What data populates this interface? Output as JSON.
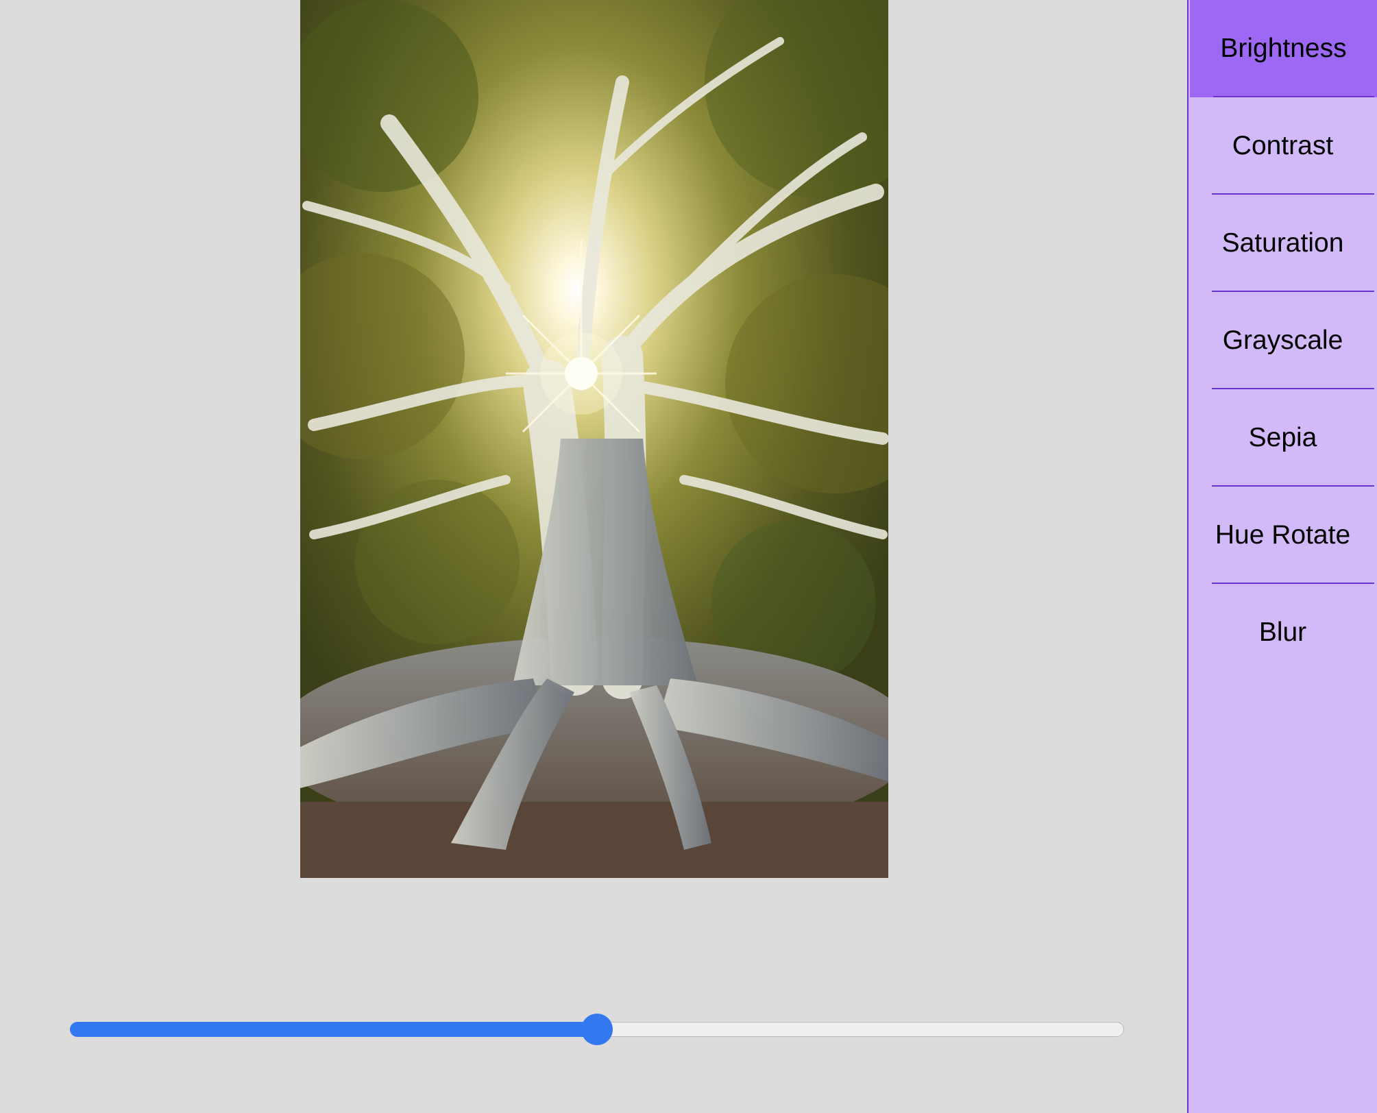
{
  "photo": {
    "subject": "large banyan tree with sun shining through branches"
  },
  "slider": {
    "value_fraction": 0.5,
    "track_color": "#efefef",
    "fill_color": "#3478f0"
  },
  "sidebar": {
    "background": "#d2b9f8",
    "active_color": "#9c68f4",
    "divider_color": "#6a34cf",
    "items": [
      {
        "label": "Brightness",
        "active": true
      },
      {
        "label": "Contrast",
        "active": false
      },
      {
        "label": "Saturation",
        "active": false
      },
      {
        "label": "Grayscale",
        "active": false
      },
      {
        "label": "Sepia",
        "active": false
      },
      {
        "label": "Hue Rotate",
        "active": false
      },
      {
        "label": "Blur",
        "active": false
      }
    ]
  }
}
